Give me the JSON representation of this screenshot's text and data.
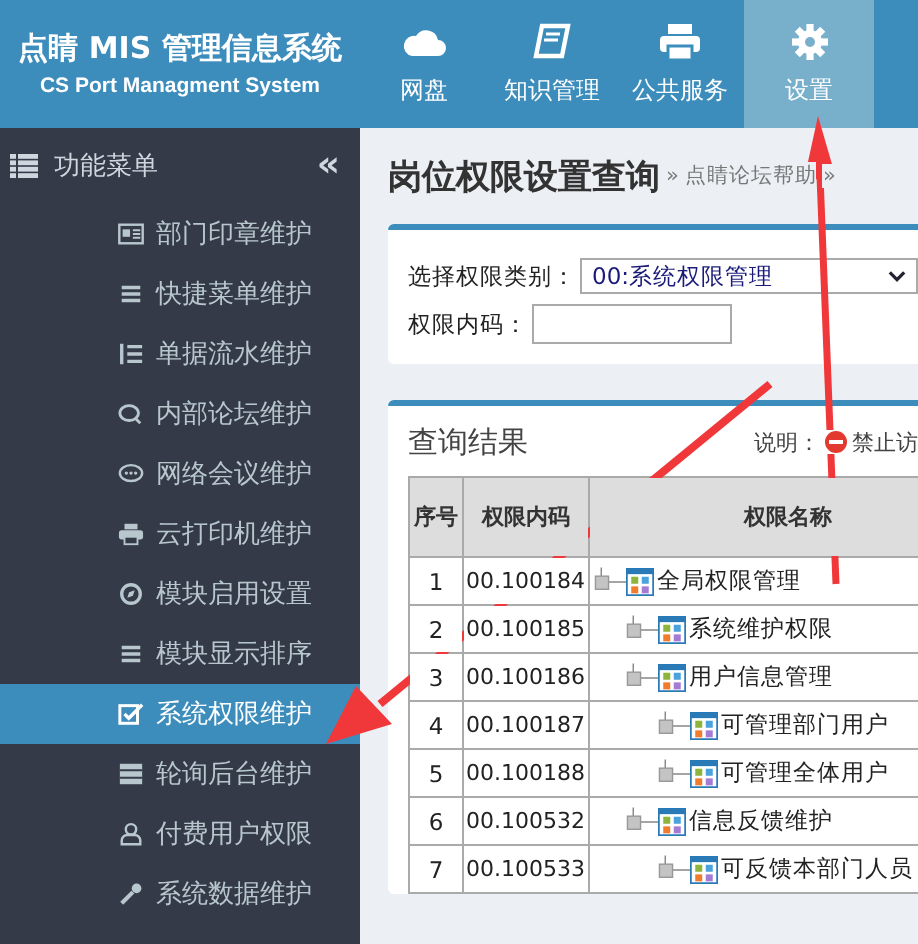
{
  "header": {
    "title": "点睛 MIS 管理信息系统",
    "subtitle": "CS Port Managment System",
    "nav": [
      {
        "kind": "cloud",
        "label": "网盘",
        "selected": false
      },
      {
        "kind": "book",
        "label": "知识管理",
        "selected": false
      },
      {
        "kind": "printer",
        "label": "公共服务",
        "selected": false
      },
      {
        "kind": "gear",
        "label": "设置",
        "selected": true
      }
    ]
  },
  "sidebar": {
    "title": "功能菜单",
    "collapse": "«",
    "items": [
      {
        "kind": "card",
        "label": "部门印章维护",
        "selected": false
      },
      {
        "kind": "bars",
        "label": "快捷菜单维护",
        "selected": false
      },
      {
        "kind": "list",
        "label": "单据流水维护",
        "selected": false
      },
      {
        "kind": "chat",
        "label": "内部论坛维护",
        "selected": false
      },
      {
        "kind": "bubble",
        "label": "网络会议维护",
        "selected": false
      },
      {
        "kind": "printer",
        "label": "云打印机维护",
        "selected": false
      },
      {
        "kind": "target",
        "label": "模块启用设置",
        "selected": false
      },
      {
        "kind": "bars",
        "label": "模块显示排序",
        "selected": false
      },
      {
        "kind": "check",
        "label": "系统权限维护",
        "selected": true
      },
      {
        "kind": "server",
        "label": "轮询后台维护",
        "selected": false
      },
      {
        "kind": "user",
        "label": "付费用户权限",
        "selected": false
      },
      {
        "kind": "wrench",
        "label": "系统数据维护",
        "selected": false
      }
    ]
  },
  "page": {
    "title": "岗位权限设置查询",
    "breadcrumb": [
      {
        "sep": "»",
        "label": "点睛论坛帮助"
      },
      {
        "sep": "»"
      }
    ]
  },
  "filter": {
    "category_label": "选择权限类别：",
    "category_value": "00:系统权限管理",
    "code_label": "权限内码："
  },
  "results": {
    "title": "查询结果",
    "legend_label": "说明：",
    "legend_item": "禁止访",
    "columns": [
      "序号",
      "权限内码",
      "权限名称"
    ],
    "rows": [
      {
        "no": "1",
        "code": "00.100184",
        "name": "全局权限管理",
        "children": [
          {
            "no": "2",
            "code": "00.100185",
            "name": "系统维护权限"
          },
          {
            "no": "3",
            "code": "00.100186",
            "name": "用户信息管理",
            "children": [
              {
                "no": "4",
                "code": "00.100187",
                "name": "可管理部门用户"
              },
              {
                "no": "5",
                "code": "00.100188",
                "name": "可管理全体用户"
              }
            ]
          },
          {
            "no": "6",
            "code": "00.100532",
            "name": "信息反馈维护",
            "children": [
              {
                "no": "7",
                "code": "00.100533",
                "name": "可反馈本部门人员"
              }
            ]
          }
        ]
      }
    ]
  }
}
